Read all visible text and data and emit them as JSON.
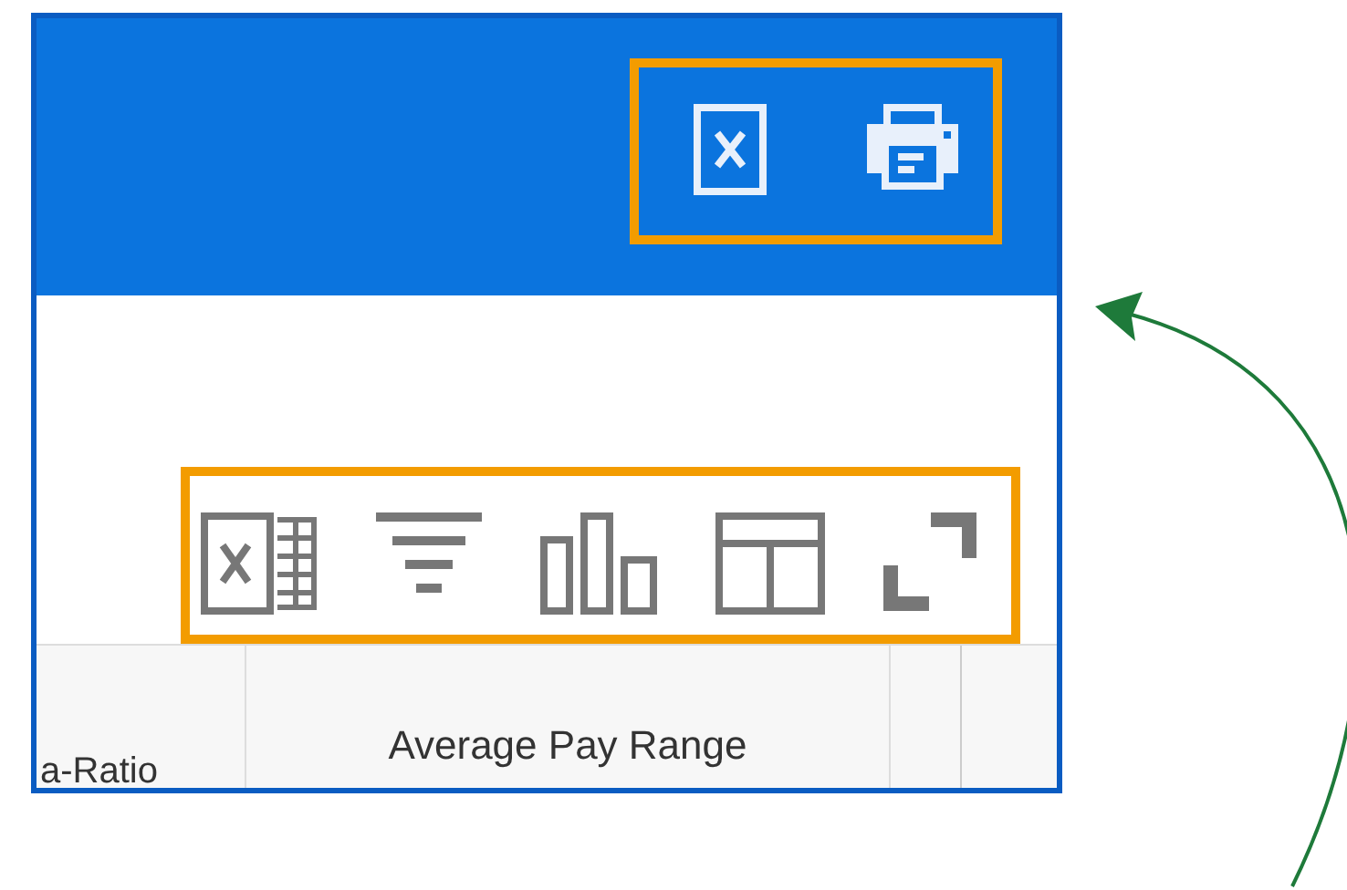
{
  "table": {
    "columns": [
      "a-Ratio",
      "Average Pay Range"
    ]
  }
}
